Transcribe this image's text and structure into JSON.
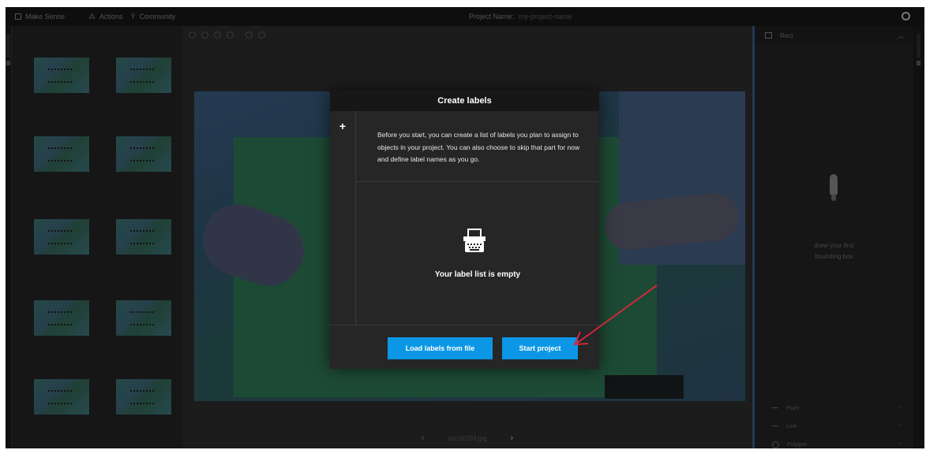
{
  "topbar": {
    "brand": "Make Sense",
    "actions": "Actions",
    "community": "Community",
    "project_label": "Project Name:",
    "project_value": "my-project-name",
    "github_icon": "github-icon"
  },
  "editor": {
    "tools": [
      "zoom-in-icon",
      "zoom-out-icon",
      "zoom-fit-icon",
      "zoom-max-icon",
      "hand-icon",
      "crosshair-icon"
    ],
    "filename": "out-00793.jpg"
  },
  "right_panel": {
    "header": "Rect",
    "empty_msg_line1": "draw your first",
    "empty_msg_line2": "bounding box",
    "rows": [
      {
        "label": "Point"
      },
      {
        "label": "Line"
      },
      {
        "label": "Polygon"
      }
    ]
  },
  "modal": {
    "title": "Create labels",
    "add_symbol": "+",
    "description": "Before you start, you can create a list of labels you plan to assign to objects in your project. You can also choose to skip that part for now and define label names as you go.",
    "empty_text": "Your label list is empty",
    "load_button": "Load labels from file",
    "start_button": "Start project"
  },
  "colors": {
    "accent": "#0b97e6",
    "annotation_arrow": "#e0263a"
  }
}
